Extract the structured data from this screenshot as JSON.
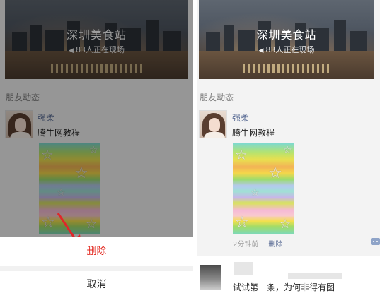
{
  "banner": {
    "title": "深圳美食站",
    "subtitle": "83人正在现场"
  },
  "section_title": "朋友动态",
  "post": {
    "author": "强柔",
    "text": "腾牛网教程",
    "time": "2分钟前",
    "delete_label": "删除"
  },
  "action_sheet": {
    "delete_label": "删除",
    "cancel_label": "取消"
  },
  "post2": {
    "text": "试试第一条，为何非得有图"
  },
  "colors": {
    "accent_link": "#5a6c95",
    "danger": "#e2231a",
    "annotation_arrow": "#e0262a"
  }
}
